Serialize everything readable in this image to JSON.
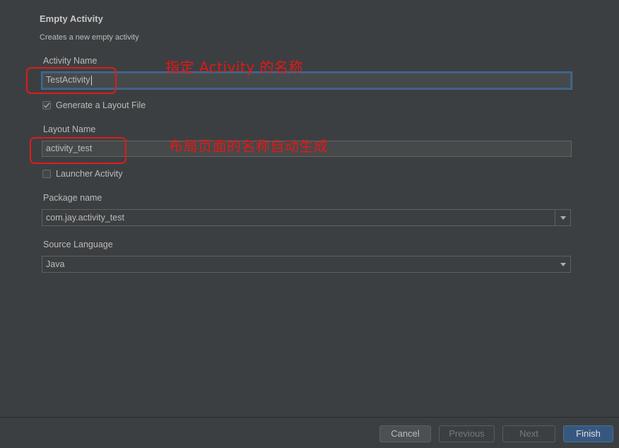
{
  "header": {
    "title": "Empty Activity",
    "subtitle": "Creates a new empty activity"
  },
  "form": {
    "activity_name_label": "Activity Name",
    "activity_name_value": "TestActivity",
    "generate_layout_label": "Generate a Layout File",
    "generate_layout_checked": true,
    "layout_name_label": "Layout Name",
    "layout_name_value": "activity_test",
    "launcher_label": "Launcher Activity",
    "launcher_checked": false,
    "package_label": "Package name",
    "package_value": "com.jay.activity_test",
    "language_label": "Source Language",
    "language_value": "Java"
  },
  "annotations": {
    "activity_note": "指定 Activity 的名称",
    "layout_note": "布局页面的名称自动生成"
  },
  "footer": {
    "cancel": "Cancel",
    "previous": "Previous",
    "next": "Next",
    "finish": "Finish"
  },
  "colors": {
    "background": "#3c3f41",
    "annotation_red": "#e51717",
    "primary_button": "#365880"
  }
}
